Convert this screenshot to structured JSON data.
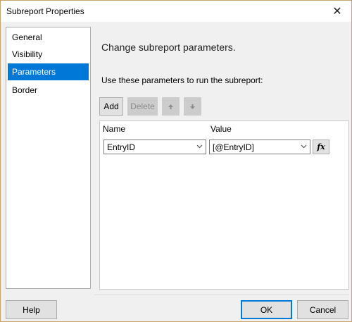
{
  "window": {
    "title": "Subreport Properties",
    "close_glyph": "✕"
  },
  "nav": {
    "items": [
      {
        "label": "General"
      },
      {
        "label": "Visibility"
      },
      {
        "label": "Parameters",
        "selected": true
      },
      {
        "label": "Border"
      }
    ]
  },
  "main": {
    "heading": "Change subreport parameters.",
    "instruction": "Use these parameters to run the subreport:",
    "toolbar": {
      "add_label": "Add",
      "delete_label": "Delete",
      "move_up_icon": "move-up-arrow",
      "move_down_icon": "move-down-arrow"
    },
    "grid": {
      "columns": [
        "Name",
        "Value"
      ],
      "rows": [
        {
          "name": "EntryID",
          "value": "[@EntryID]"
        }
      ],
      "expression_button": "fx"
    }
  },
  "footer": {
    "help_label": "Help",
    "ok_label": "OK",
    "cancel_label": "Cancel"
  },
  "colors": {
    "accent": "#0078d7",
    "window_bg": "#f0f0f0",
    "button_bg": "#e1e1e1",
    "disabled_bg": "#cccccc"
  }
}
